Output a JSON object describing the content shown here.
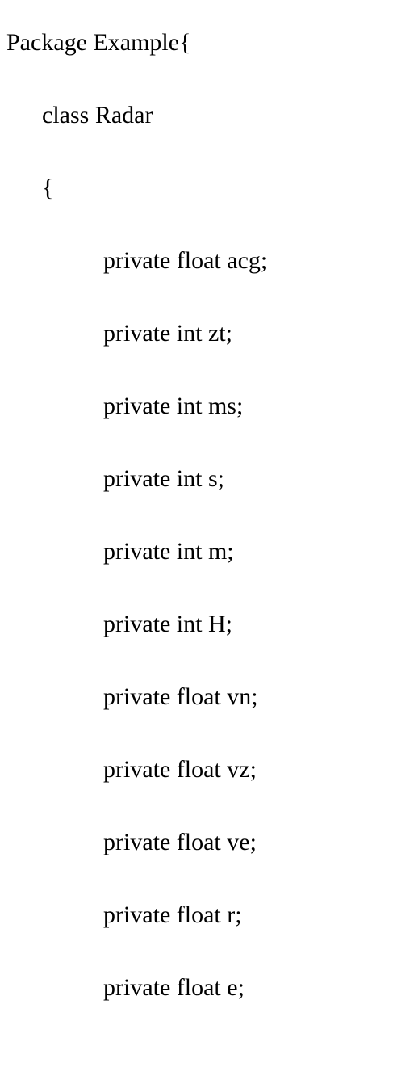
{
  "lines": [
    {
      "text": "Package Example{",
      "indent": 0
    },
    {
      "text": "class Radar",
      "indent": 1
    },
    {
      "text": "{",
      "indent": 1
    },
    {
      "text": "private float acg;",
      "indent": 2
    },
    {
      "text": "private int zt;",
      "indent": 2
    },
    {
      "text": "private int ms;",
      "indent": 2
    },
    {
      "text": "private int s;",
      "indent": 2
    },
    {
      "text": "private int m;",
      "indent": 2
    },
    {
      "text": "private int H;",
      "indent": 2
    },
    {
      "text": "private float vn;",
      "indent": 2
    },
    {
      "text": "private float vz;",
      "indent": 2
    },
    {
      "text": "private float ve;",
      "indent": 2
    },
    {
      "text": "private float r;",
      "indent": 2
    },
    {
      "text": "private float e;",
      "indent": 2
    }
  ]
}
